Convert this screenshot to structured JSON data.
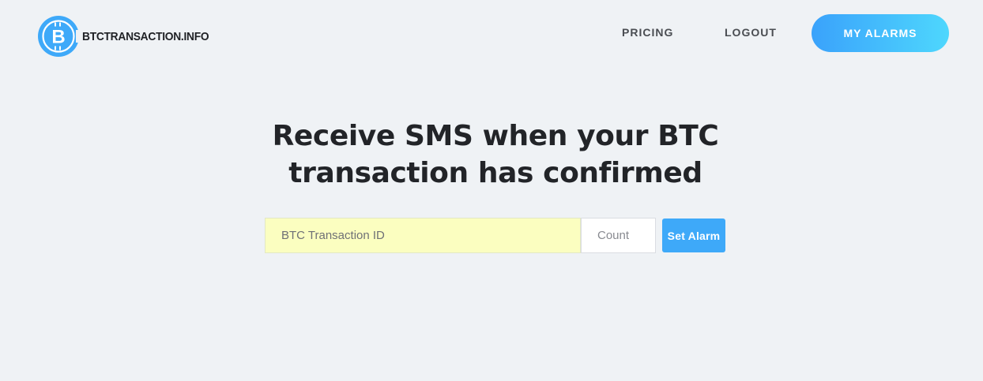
{
  "brand": {
    "name": "BTCTRANSACTION.INFO",
    "logo_icon": "bitcoin-icon",
    "logo_color": "#3ea9f9"
  },
  "nav": {
    "pricing_label": "PRICING",
    "logout_label": "LOGOUT",
    "cta_label": "MY ALARMS"
  },
  "hero": {
    "title_line1": "Receive SMS when your BTC",
    "title_line2": "transaction has confirmed"
  },
  "form": {
    "tx_placeholder": "BTC Transaction ID",
    "count_placeholder": "Count",
    "submit_label": "Set Alarm"
  },
  "colors": {
    "background": "#eff2f5",
    "accent": "#3ea9f9",
    "cta_gradient_start": "#3aa2fb",
    "cta_gradient_end": "#4ed7fd",
    "input_highlight": "#fbfec0"
  }
}
